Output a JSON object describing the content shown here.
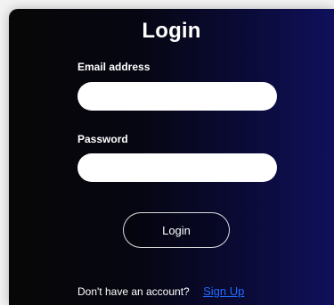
{
  "login": {
    "title": "Login",
    "email_label": "Email address",
    "email_value": "",
    "email_placeholder": "",
    "password_label": "Password",
    "password_value": "",
    "password_placeholder": "",
    "submit_label": "Login",
    "prompt_text": "Don't have an account?",
    "signup_link": "Sign Up"
  },
  "colors": {
    "background": "#f2f2f2",
    "card_gradient_start": "#070707",
    "card_gradient_end": "#10105d",
    "text": "#ffffff",
    "link": "#1e6bff",
    "input_bg": "#ffffff"
  }
}
